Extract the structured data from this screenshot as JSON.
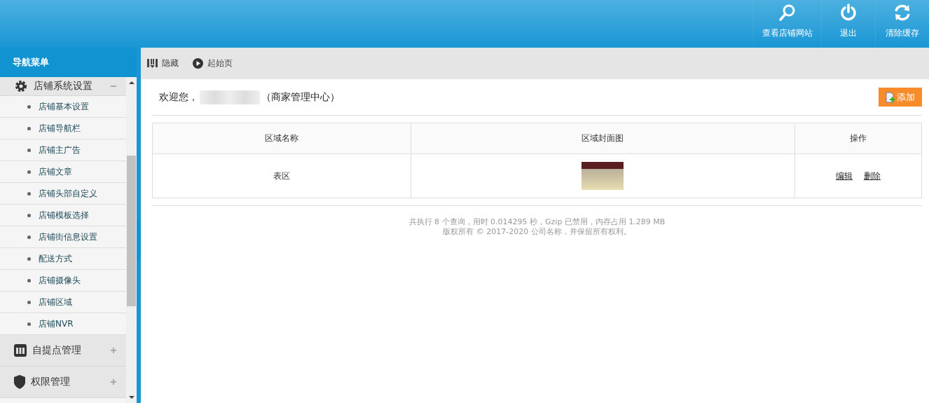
{
  "header": {
    "actions": [
      {
        "kind": "search",
        "label": "查看店铺网站"
      },
      {
        "kind": "power",
        "label": "退出"
      },
      {
        "kind": "refresh",
        "label": "清除缓存"
      }
    ]
  },
  "sidebar": {
    "title": "导航菜单",
    "groups": [
      {
        "kind": "gear",
        "label": "店铺系统设置",
        "expanded": true,
        "children": [
          {
            "label": "店铺基本设置"
          },
          {
            "label": "店铺导航栏"
          },
          {
            "label": "店铺主广告"
          },
          {
            "label": "店铺文章"
          },
          {
            "label": "店铺头部自定义"
          },
          {
            "label": "店铺模板选择"
          },
          {
            "label": "店铺街信息设置"
          },
          {
            "label": "配送方式"
          },
          {
            "label": "店铺摄像头"
          },
          {
            "label": "店铺区域"
          },
          {
            "label": "店铺NVR"
          }
        ]
      },
      {
        "kind": "case",
        "label": "自提点管理",
        "expanded": false
      },
      {
        "kind": "shield",
        "label": "权限管理",
        "expanded": false
      }
    ]
  },
  "toolbar": {
    "items": [
      {
        "kind": "hide",
        "label": "隐藏"
      },
      {
        "kind": "play",
        "label": "起始页"
      }
    ]
  },
  "welcome": {
    "greeting": "欢迎您，",
    "suffix": "（商家管理中心）"
  },
  "add_button": "添加",
  "table": {
    "columns": [
      "区域名称",
      "区域封面图",
      "操作"
    ],
    "rows": [
      {
        "name": "表区",
        "actions": [
          "编辑",
          "删除"
        ]
      }
    ]
  },
  "footer": [
    "共执行 8 个查询，用时 0.014295 秒，Gzip 已禁用，内存占用 1.289 MB",
    "版权所有 © 2017-2020 公司名称，并保留所有权利。"
  ]
}
